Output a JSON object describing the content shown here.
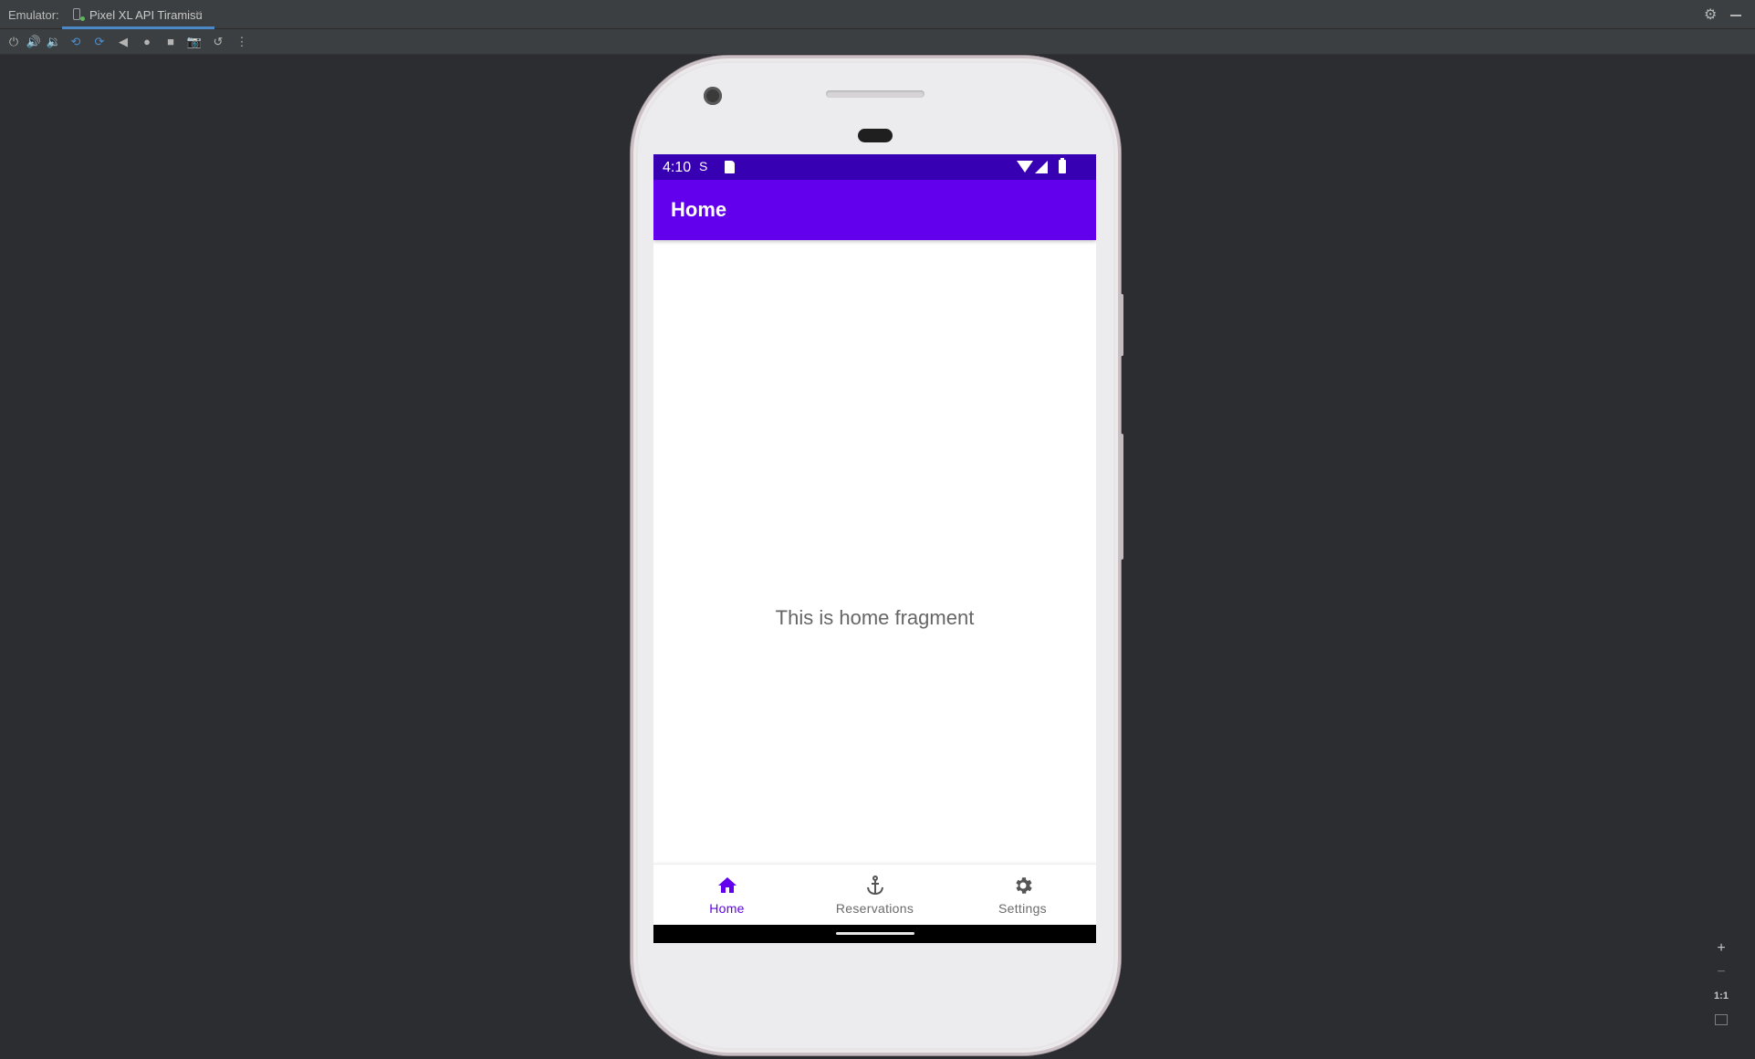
{
  "ide": {
    "panel_label": "Emulator:",
    "tab_label": "Pixel XL API Tiramisu",
    "tab_close": "×",
    "settings_icon": "gear-icon",
    "minimize_icon": "minimize-icon"
  },
  "toolbar": {
    "buttons": [
      {
        "name": "power",
        "glyph": "⏻"
      },
      {
        "name": "volume-up",
        "glyph": "🔊"
      },
      {
        "name": "volume-down",
        "glyph": "🔉"
      },
      {
        "name": "rotate-left",
        "glyph": "⟲"
      },
      {
        "name": "rotate-right",
        "glyph": "⟳"
      },
      {
        "name": "back",
        "glyph": "◀"
      },
      {
        "name": "home",
        "glyph": "●"
      },
      {
        "name": "overview",
        "glyph": "■"
      },
      {
        "name": "screenshot",
        "glyph": "📷"
      },
      {
        "name": "snapshot",
        "glyph": "↺"
      },
      {
        "name": "more",
        "glyph": "⋮"
      }
    ]
  },
  "device": {
    "status_bar": {
      "time": "4:10",
      "sync_icon": "sync-icon",
      "sd_icon": "sd-card-icon",
      "wifi_icon": "wifi-icon",
      "signal_icon": "signal-icon",
      "battery_icon": "battery-icon"
    },
    "app_bar": {
      "title": "Home"
    },
    "content": {
      "message": "This is home fragment"
    },
    "bottom_nav": {
      "items": [
        {
          "label": "Home",
          "icon": "home-icon",
          "active": true
        },
        {
          "label": "Reservations",
          "icon": "anchor-icon",
          "active": false
        },
        {
          "label": "Settings",
          "icon": "gear-icon",
          "active": false
        }
      ]
    },
    "colors": {
      "primary": "#6200ee",
      "primary_dark": "#3700b3"
    }
  },
  "zoom": {
    "zoom_in": "+",
    "zoom_out": "−",
    "actual_size": "1:1"
  }
}
